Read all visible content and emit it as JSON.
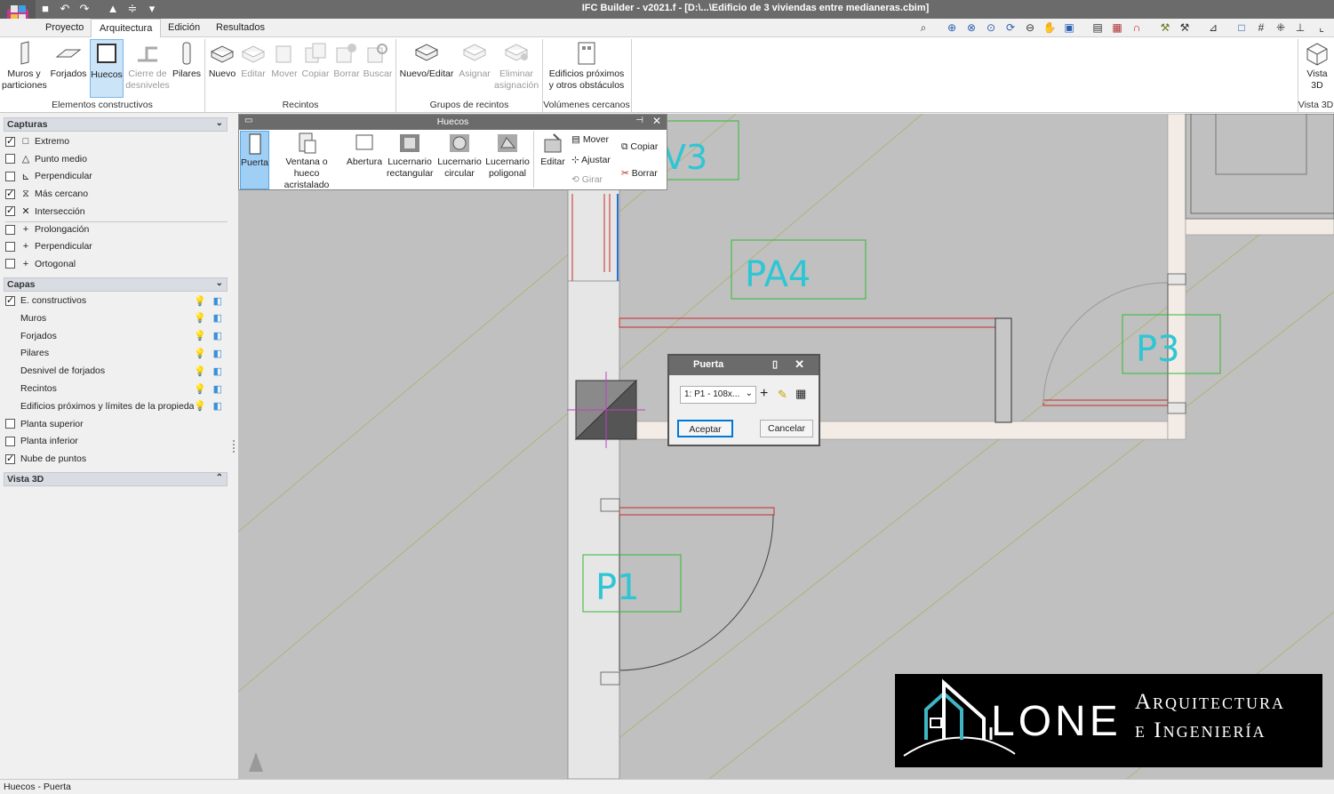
{
  "window": {
    "title": "IFC Builder - v2021.f - [D:\\...\\Edificio de 3 viviendas entre medianeras.cbim]"
  },
  "quick_access": [
    "save-icon",
    "undo-icon",
    "redo-icon",
    "up-icon",
    "level-icon",
    "dropdown-icon"
  ],
  "menu": {
    "tabs": [
      "Proyecto",
      "Arquitectura",
      "Edición",
      "Resultados"
    ],
    "active": "Arquitectura"
  },
  "ribbon": {
    "elementos": {
      "label": "Elementos constructivos",
      "buttons": [
        "Muros y particiones",
        "Forjados",
        "Huecos",
        "Cierre de desniveles",
        "Pilares"
      ]
    },
    "recintos": {
      "label": "Recintos",
      "buttons": [
        "Nuevo",
        "Editar",
        "Mover",
        "Copiar",
        "Borrar",
        "Buscar"
      ]
    },
    "grupos": {
      "label": "Grupos de recintos",
      "buttons": [
        "Nuevo/Editar",
        "Asignar",
        "Eliminar asignación"
      ]
    },
    "volumenes": {
      "label": "Volúmenes cercanos",
      "buttons": [
        "Edificios próximos y otros obstáculos"
      ]
    },
    "vista3d": {
      "label": "Vista 3D",
      "buttons": [
        "Vista 3D"
      ]
    }
  },
  "panel": {
    "capturas": {
      "title": "Capturas",
      "items": [
        {
          "label": "Extremo",
          "checked": true,
          "sym": "□"
        },
        {
          "label": "Punto medio",
          "checked": false,
          "sym": "△"
        },
        {
          "label": "Perpendicular",
          "checked": false,
          "sym": "⊾"
        },
        {
          "label": "Más cercano",
          "checked": true,
          "sym": "⧖"
        },
        {
          "label": "Intersección",
          "checked": true,
          "sym": "✕"
        },
        {
          "label": "Prolongación",
          "checked": false,
          "sym": "+"
        },
        {
          "label": "Perpendicular",
          "checked": false,
          "sym": "+"
        },
        {
          "label": "Ortogonal",
          "checked": false,
          "sym": "+"
        }
      ]
    },
    "capas": {
      "title": "Capas",
      "items": [
        {
          "label": "E. constructivos",
          "checked": true
        },
        {
          "label": "Muros"
        },
        {
          "label": "Forjados"
        },
        {
          "label": "Pilares"
        },
        {
          "label": "Desnivel de forjados"
        },
        {
          "label": "Recintos"
        },
        {
          "label": "Edificios próximos y límites de la propiedad"
        },
        {
          "label": "Planta superior",
          "checked": false
        },
        {
          "label": "Planta inferior",
          "checked": false
        },
        {
          "label": "Nube de puntos",
          "checked": true
        }
      ]
    },
    "vista3d": {
      "title": "Vista 3D"
    }
  },
  "huecos": {
    "title": "Huecos",
    "buttons": [
      "Puerta",
      "Ventana o hueco acristalado",
      "Abertura",
      "Lucernario rectangular",
      "Lucernario circular",
      "Lucernario poligonal",
      "Editar"
    ],
    "side": [
      "Mover",
      "Ajustar",
      "Girar",
      "Copiar",
      "Borrar"
    ]
  },
  "puerta": {
    "title": "Puerta",
    "select": "1: P1 - 108x...",
    "ok": "Aceptar",
    "cancel": "Cancelar"
  },
  "canvas": {
    "labels": [
      "PA4",
      "P3",
      "P1",
      "V3"
    ]
  },
  "logo": {
    "mark": "LONE",
    "line1": "Arquitectura",
    "line2": "e Ingeniería"
  },
  "status": "Huecos - Puerta"
}
